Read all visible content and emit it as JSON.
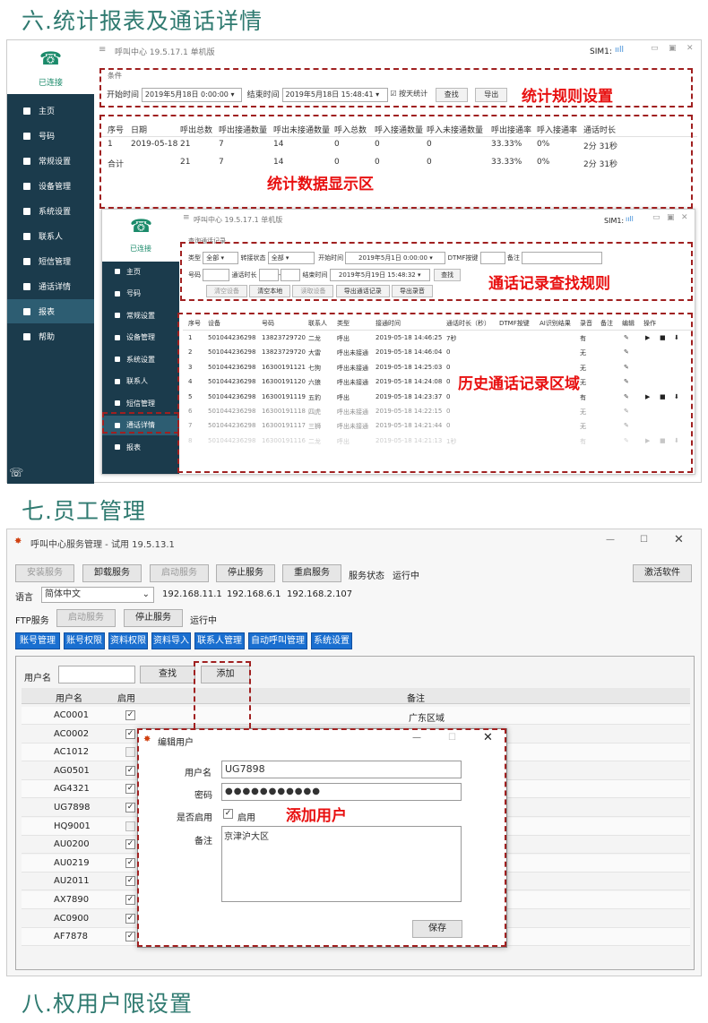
{
  "headings": {
    "h6": "六.统计报表及通话详情",
    "h7": "七.员工管理",
    "h8": "八.权用户限设置"
  },
  "callouts": {
    "stats_rules": "统计规则设置",
    "stats_area": "统计数据显示区",
    "call_rules": "通话记录查找规则",
    "call_area": "历史通话记录区域",
    "add_user": "添加用户"
  },
  "app1": {
    "title": "呼叫中心  19.5.17.1  单机版",
    "sim": "SIM1:",
    "status": "已连接",
    "nav": [
      "主页",
      "号码",
      "常规设置",
      "设备管理",
      "系统设置",
      "联系人",
      "短信管理",
      "通话详情",
      "报表",
      "帮助"
    ],
    "cond_label": "条件",
    "start_label": "开始时间",
    "start_value": "2019年5月18日 0:00:00",
    "end_label": "结束时间",
    "end_value": "2019年5月18日 15:48:41",
    "by_day": "按天统计",
    "query": "查找",
    "export": "导出",
    "headers": [
      "序号",
      "日期",
      "呼出总数",
      "呼出接通数量",
      "呼出未接通数量",
      "呼入总数",
      "呼入接通数量",
      "呼入未接通数量",
      "呼出接通率",
      "呼入接通率",
      "通话时长"
    ],
    "rows": [
      [
        "1",
        "2019-05-18",
        "21",
        "7",
        "14",
        "0",
        "0",
        "0",
        "33.33%",
        "0%",
        "2分 31秒"
      ],
      [
        "合计",
        "",
        "21",
        "7",
        "14",
        "0",
        "0",
        "0",
        "33.33%",
        "0%",
        "2分 31秒"
      ]
    ]
  },
  "app2": {
    "title": "呼叫中心  19.5.17.1  单机版",
    "sim": "SIM1:",
    "status": "已连接",
    "nav": [
      "主页",
      "号码",
      "常规设置",
      "设备管理",
      "系统设置",
      "联系人",
      "短信管理",
      "通话详情",
      "报表"
    ],
    "group": "查询通话记录",
    "type_l": "类型",
    "type_v": "全部",
    "transfer_l": "转接状态",
    "transfer_v": "全部",
    "start_l": "开始时间",
    "start_v": "2019年5月1日 0:00:00",
    "dtmf_l": "DTMF按键",
    "note_l": "备注",
    "num_l": "号码",
    "dur_l": "通话时长",
    "end_l": "结束时间",
    "end_v": "2019年5月19日 15:48:32",
    "query": "查找",
    "b_clear_dev": "清空设备",
    "b_clear_local": "清空本地",
    "b_read_dev": "读取设备",
    "b_export": "导出通话记录",
    "b_rec": "导出录音",
    "headers": [
      "序号",
      "设备",
      "号码",
      "联系人",
      "类型",
      "接通时间",
      "通话时长（秒）",
      "DTMF按键",
      "AI识别结果",
      "录音",
      "备注",
      "编辑",
      "操作"
    ],
    "rows": [
      [
        "1",
        "501044236298",
        "13823729720",
        "二龙",
        "呼出",
        "2019-05-18 14:46:25",
        "7秒",
        "",
        "",
        "有"
      ],
      [
        "2",
        "501044236298",
        "13823729720",
        "大雷",
        "呼出未接通",
        "2019-05-18 14:46:04",
        "0",
        "",
        "",
        "无"
      ],
      [
        "3",
        "501044236298",
        "16300191121",
        "七狗",
        "呼出未接通",
        "2019-05-18 14:25:03",
        "0",
        "",
        "",
        "无"
      ],
      [
        "4",
        "501044236298",
        "16300191120",
        "六狼",
        "呼出未接通",
        "2019-05-18 14:24:08",
        "0",
        "",
        "",
        "无"
      ],
      [
        "5",
        "501044236298",
        "16300191119",
        "五豹",
        "呼出",
        "2019-05-18 14:23:37",
        "0",
        "",
        "",
        "有"
      ],
      [
        "6",
        "501044236298",
        "16300191118",
        "四虎",
        "呼出未接通",
        "2019-05-18 14:22:15",
        "0",
        "",
        "",
        "无"
      ],
      [
        "7",
        "501044236298",
        "16300191117",
        "三狮",
        "呼出未接通",
        "2019-05-18 14:21:44",
        "0",
        "",
        "",
        "无"
      ],
      [
        "8",
        "501044236298",
        "16300191116",
        "二龙",
        "呼出",
        "2019-05-18 14:21:13",
        "1秒",
        "",
        "",
        "有"
      ]
    ]
  },
  "app3": {
    "title": "呼叫中心服务管理 - 试用  19.5.13.1",
    "b_install": "安装服务",
    "b_uninstall": "卸载服务",
    "b_start": "启动服务",
    "b_stop": "停止服务",
    "b_restart": "重启服务",
    "svc_status_l": "服务状态",
    "svc_status_v": "运行中",
    "b_activate": "激活软件",
    "lang_l": "语言",
    "lang_v": "简体中文",
    "ips": [
      "192.168.11.1",
      "192.168.6.1",
      "192.168.2.107"
    ],
    "ftp_l": "FTP服务",
    "ftp_start": "启动服务",
    "ftp_stop": "停止服务",
    "ftp_status": "运行中",
    "tabs": [
      "账号管理",
      "账号权限",
      "资料权限",
      "资料导入",
      "联系人管理",
      "自动呼叫管理",
      "系统设置"
    ],
    "user_l": "用户名",
    "find": "查找",
    "add": "添加",
    "col_user": "用户名",
    "col_enable": "启用",
    "col_note": "备注",
    "users": [
      [
        "AC0001",
        true,
        "广东区域"
      ],
      [
        "AC0002",
        true,
        ""
      ],
      [
        "AC1012",
        false,
        ""
      ],
      [
        "AG0501",
        true,
        ""
      ],
      [
        "AG4321",
        true,
        ""
      ],
      [
        "UG7898",
        true,
        ""
      ],
      [
        "HQ9001",
        false,
        ""
      ],
      [
        "AU0200",
        true,
        ""
      ],
      [
        "AU0219",
        true,
        ""
      ],
      [
        "AU2011",
        true,
        ""
      ],
      [
        "AX7890",
        true,
        ""
      ],
      [
        "AC0900",
        true,
        ""
      ],
      [
        "AF7878",
        true,
        ""
      ]
    ],
    "dlg": {
      "title": "编辑用户",
      "user_l": "用户名",
      "user_v": "UG7898",
      "pwd_l": "密码",
      "pwd_v": "●●●●●●●●●●●",
      "en_l": "是否启用",
      "en_v": "启用",
      "note_l": "备注",
      "note_v": "京津沪大区",
      "save": "保存"
    }
  }
}
